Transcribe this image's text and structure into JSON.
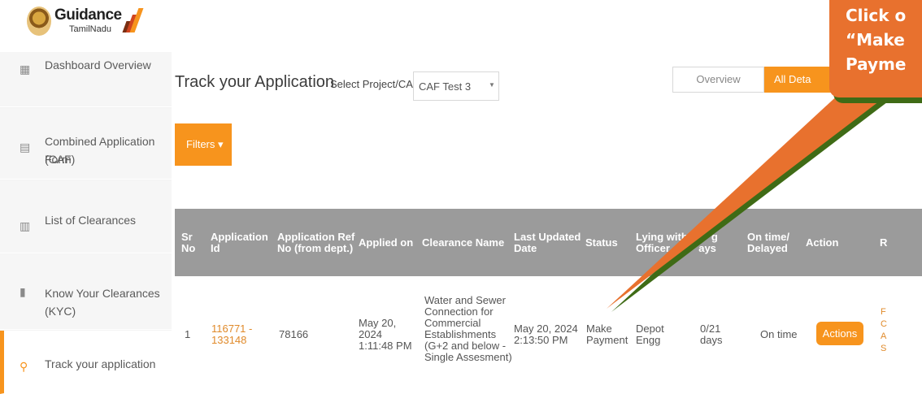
{
  "logo": {
    "title": "Guidance",
    "subtitle": "TamilNadu"
  },
  "sidebar": {
    "items": [
      {
        "label": "Dashboard Overview",
        "icon": "grid-icon"
      },
      {
        "label": "Combined Application Form",
        "label2": "(CAF)",
        "icon": "document-icon"
      },
      {
        "label": "List of Clearances",
        "icon": "list-icon"
      },
      {
        "label": "Know Your Clearances (KYC)",
        "icon": "book-icon"
      },
      {
        "label": "Track your application",
        "icon": "location-pin-icon"
      }
    ]
  },
  "header": {
    "title": "Track your Application",
    "select_label": "Select Project/CAF",
    "select_value": "CAF Test 3",
    "tab_overview": "Overview",
    "tab_all": "All Deta"
  },
  "filters_label": "Filters ▾",
  "table": {
    "columns": [
      {
        "l1": "Sr",
        "l2": "No"
      },
      {
        "l1": "Application",
        "l2": "Id"
      },
      {
        "l1": "Application Ref",
        "l2": "No (from dept.)"
      },
      {
        "l1": "Applied on",
        "l2": ""
      },
      {
        "l1": "Clearance Name",
        "l2": ""
      },
      {
        "l1": "Last Updated",
        "l2": "Date"
      },
      {
        "l1": "Status",
        "l2": ""
      },
      {
        "l1": "Lying with",
        "l2": "Officer"
      },
      {
        "l1": "P    g",
        "l2": "  ays"
      },
      {
        "l1": "On time/",
        "l2": "Delayed"
      },
      {
        "l1": "Action",
        "l2": ""
      },
      {
        "l1": "R",
        "l2": ""
      }
    ],
    "row": {
      "sr": "1",
      "app_id": [
        "116771 -",
        "133148"
      ],
      "ref_no": "78166",
      "applied_on": [
        "May 20,",
        "2024",
        "1:11:48 PM"
      ],
      "clearance": [
        "Water and Sewer",
        "Connection for",
        "Commercial",
        "Establishments",
        "(G+2 and below -",
        "Single Assesment)"
      ],
      "last_updated": [
        "May 20, 2024",
        "2:13:50 PM"
      ],
      "status": [
        "Make",
        "Payment"
      ],
      "officer": [
        "Depot",
        "Engg"
      ],
      "days": [
        "0/21",
        "days"
      ],
      "ontime": "On time",
      "action": "Actions",
      "remarks": [
        "F",
        "C",
        "A",
        "S"
      ]
    }
  },
  "callout": {
    "line1": "Click o",
    "line2": "“Make",
    "line3": "Payme"
  },
  "colors": {
    "accent": "#f7941d",
    "callout": "#e8712e",
    "callout_shadow": "#3f6b16",
    "header": "#9b9b9b"
  }
}
